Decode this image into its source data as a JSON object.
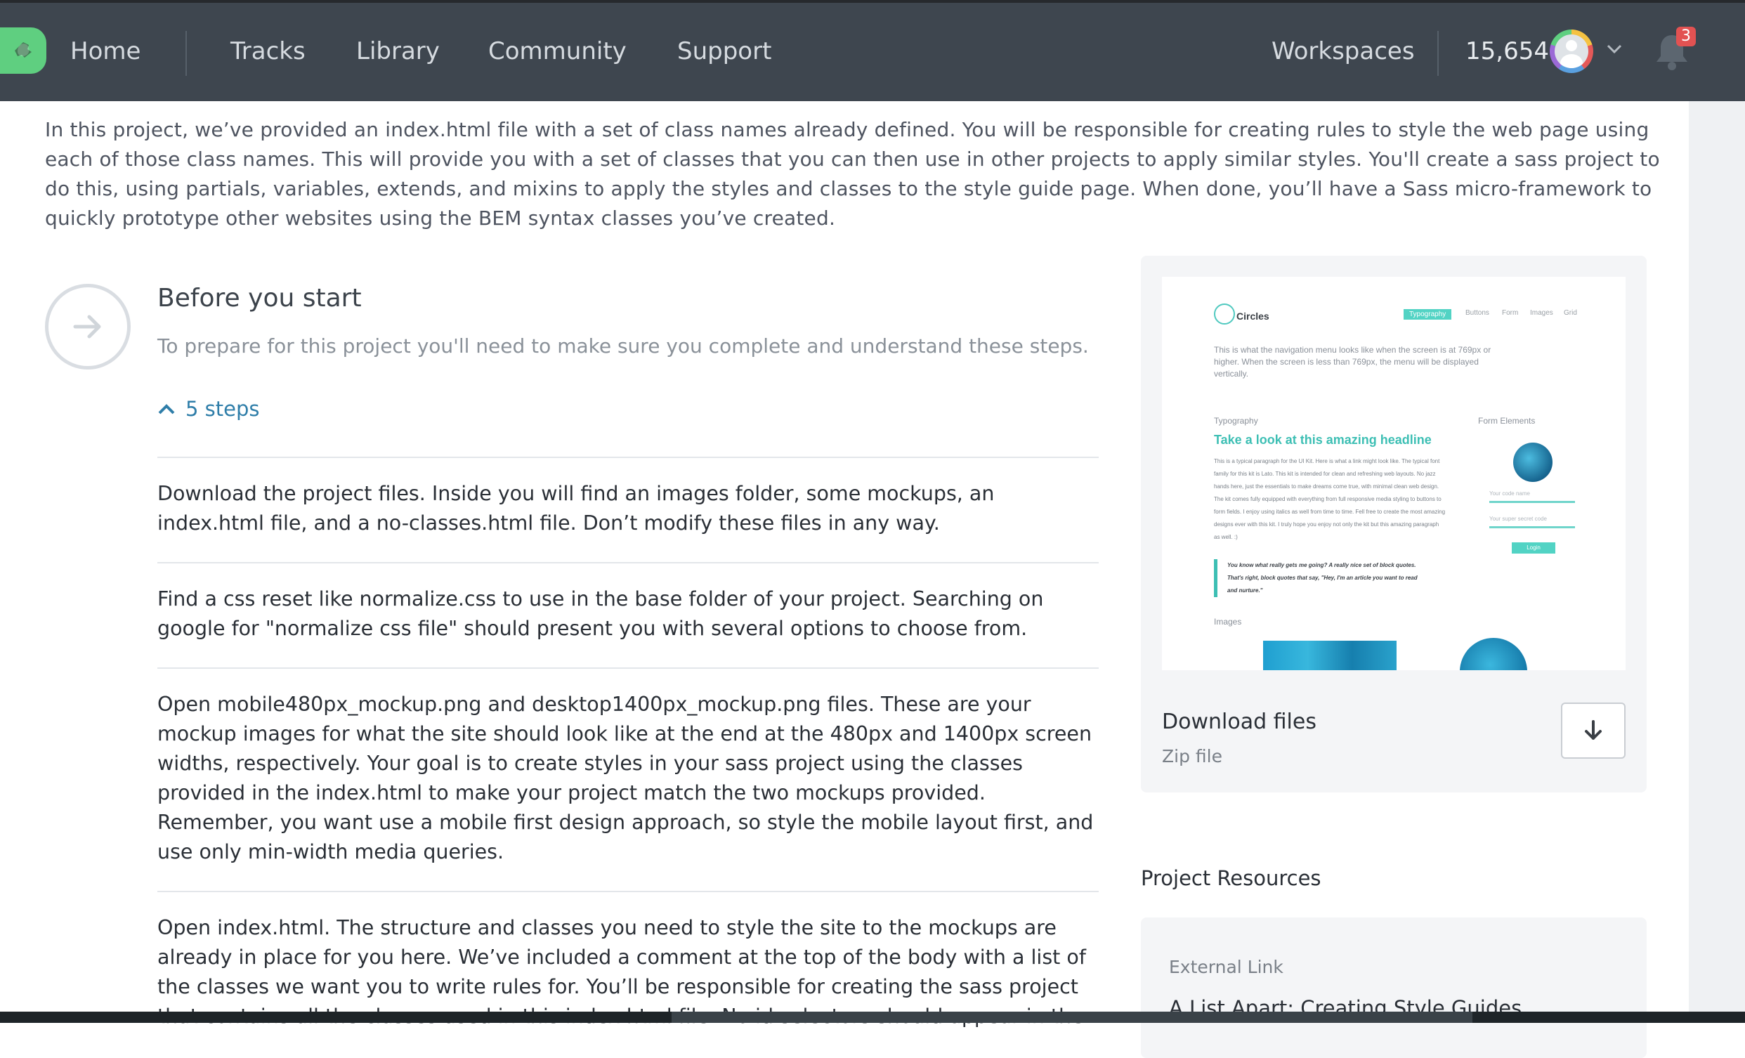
{
  "nav": {
    "home": "Home",
    "tracks": "Tracks",
    "library": "Library",
    "community": "Community",
    "support": "Support",
    "workspaces": "Workspaces",
    "points": "15,654",
    "notifications_count": "3"
  },
  "intro": "In this project, we’ve provided an index.html file with a set of class names already defined. You will be responsible for creating rules to style the web page using each of those class names. This will provide you with a set of classes that you can then use in other projects to apply similar styles. You'll create a sass project to do this, using partials, variables, extends, and mixins to apply the styles and classes to the style guide page. When done, you’ll have a Sass micro-framework to quickly prototype other websites using the BEM syntax classes you’ve created.",
  "before": {
    "title": "Before you start",
    "subtitle": "To prepare for this project you'll need to make sure you complete and understand these steps.",
    "steps_toggle": "5 steps",
    "steps": [
      "Download the project files. Inside you will find an images folder, some mockups, an index.html file, and a no-classes.html file. Don’t modify these files in any way.",
      "Find a css reset like normalize.css to use in the base folder of your project. Searching on google for \"normalize css file\" should present you with several options to choose from.",
      "Open mobile480px_mockup.png and desktop1400px_mockup.png files. These are your mockup images for what the site should look like at the end at the 480px and 1400px screen widths, respectively. Your goal is to create styles in your sass project using the classes provided in the index.html to make your project match the two mockups provided. Remember, you want use a mobile first design approach, so style the mobile layout first, and use only min-width media queries.",
      "Open index.html. The structure and classes you need to style the site to the mockups are already in place for you here. We’ve included a comment at the top of the body with a list of the classes we want you to write rules for. You’ll be responsible for creating the sass project that contains all the classes used in this index.html file. No id selectors should appear in the"
    ]
  },
  "download": {
    "title": "Download files",
    "subtitle": "Zip file"
  },
  "preview": {
    "brand": "Circles",
    "tabs": [
      "Typography",
      "Buttons",
      "Form",
      "Images",
      "Grid"
    ],
    "nav_note": "This is what the navigation menu looks like when the screen is at 769px or higher. When the screen is less than 769px, the menu will be displayed vertically.",
    "typography_label": "Typography",
    "form_label": "Form Elements",
    "headline": "Take a look at this amazing headline",
    "body": "This is a typical paragraph for the UI Kit. Here is what a link might look like. The typical font family for this kit is Lato. This kit is intended for clean and refreshing web layouts. No jazz hands here, just the essentials to make dreams come true, with minimal clean web design. The kit comes fully equipped with everything from full responsive media styling to buttons to form fields. I enjoy using italics as well from time to time. Fell free to create the most amazing designs ever with this kit. I truly hope you enjoy not only the kit but this amazing paragraph as well. :)",
    "quote": "You know what really gets me going? A really nice set of block quotes. That's right, block quotes that say, \"Hey, I'm an article you want to read and nurture.\"",
    "field1": "Your code name",
    "field2": "Your super secret code",
    "login": "Login",
    "images_label": "Images"
  },
  "resources": {
    "title": "Project Resources",
    "type": "External Link",
    "link": "A List Apart: Creating Style Guides"
  },
  "colors": {
    "topbar": "#3e464f",
    "accent": "#2f7ea9",
    "brand_green": "#5fcf80",
    "badge": "#e25252"
  }
}
